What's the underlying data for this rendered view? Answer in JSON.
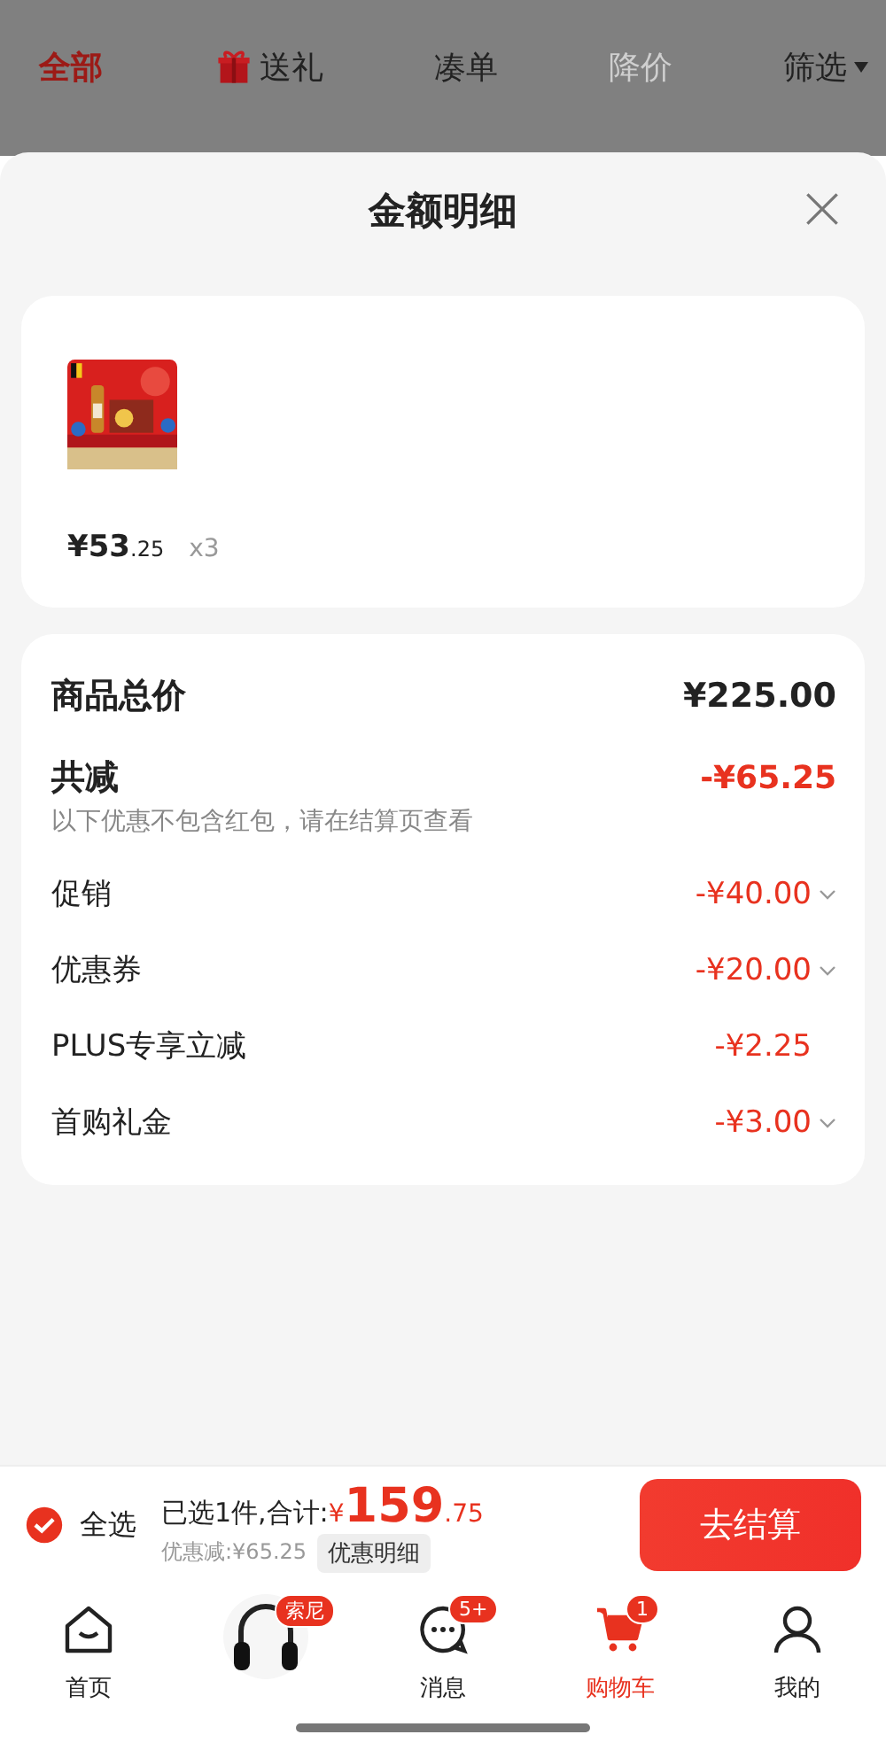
{
  "filter_tabs": [
    {
      "label": "全部",
      "selected": true,
      "disabled": false,
      "kind": "text"
    },
    {
      "label": "送礼",
      "selected": false,
      "disabled": false,
      "kind": "gift"
    },
    {
      "label": "凑单",
      "selected": false,
      "disabled": false,
      "kind": "text"
    },
    {
      "label": "降价",
      "selected": false,
      "disabled": true,
      "kind": "text"
    },
    {
      "label": "筛选",
      "selected": false,
      "disabled": false,
      "kind": "dropdown"
    }
  ],
  "sheet": {
    "title": "金额明细",
    "items": [
      {
        "kind": "picture",
        "price_main": "¥53",
        "price_decimal": ".25",
        "quantity": "x3"
      }
    ],
    "summary_rows": [
      {
        "kind": "total",
        "label": "商品总价",
        "value": "¥225.00",
        "expandable": false
      },
      {
        "kind": "discount",
        "label": "共减",
        "value": "-¥65.25",
        "note": "以下优惠不包含红包，请在结算页查看",
        "expandable": false
      },
      {
        "kind": "line",
        "label": "促销",
        "value": "-¥40.00",
        "expandable": true
      },
      {
        "kind": "line",
        "label": "优惠券",
        "value": "-¥20.00",
        "expandable": true
      },
      {
        "kind": "line",
        "label": "PLUS专享立减",
        "value": "-¥2.25",
        "expandable": false
      },
      {
        "kind": "line",
        "label": "首购礼金",
        "value": "-¥3.00",
        "expandable": true
      }
    ]
  },
  "checkout_bar": {
    "select_all": {
      "label": "全选",
      "checked": true
    },
    "selected_text": "已选1件,合计:",
    "currency": "¥",
    "total_main": "159",
    "total_decimal": ".75",
    "discount_text": "优惠减:¥65.25",
    "detail_button": "优惠明细",
    "checkout_button": "去结算"
  },
  "bottom_nav": [
    {
      "kind": "home",
      "label": "首页",
      "selected": false
    },
    {
      "kind": "headphones",
      "badge": "索尼",
      "selected": false
    },
    {
      "kind": "message",
      "label": "消息",
      "badge": "5+",
      "selected": false
    },
    {
      "kind": "cart",
      "label": "购物车",
      "badge": "1",
      "selected": true
    },
    {
      "kind": "profile",
      "label": "我的",
      "selected": false
    }
  ]
}
